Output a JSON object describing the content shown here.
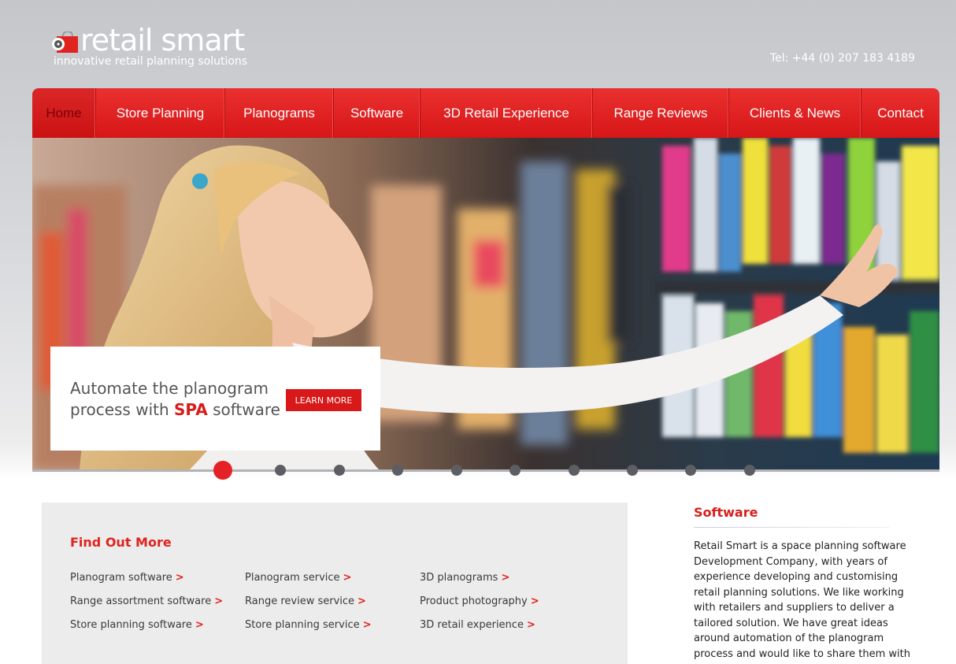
{
  "header": {
    "logo_name": "retail smart",
    "logo_tagline": "innovative retail planning solutions",
    "phone": "Tel: +44 (0) 207 183 4189"
  },
  "nav": {
    "items": [
      {
        "label": "Home",
        "active": true
      },
      {
        "label": "Store Planning"
      },
      {
        "label": "Planograms"
      },
      {
        "label": "Software"
      },
      {
        "label": "3D Retail Experience"
      },
      {
        "label": "Range Reviews"
      },
      {
        "label": "Clients & News"
      },
      {
        "label": "Contact"
      }
    ]
  },
  "hero": {
    "promo_line1": "Automate the planogram",
    "promo_line2_prefix": "process with ",
    "promo_highlight": "SPA",
    "promo_line2_suffix": " software",
    "button_label": "LEARN MORE"
  },
  "slider": {
    "slide_count": 10,
    "active_index": 0
  },
  "find_out_more": {
    "title": "Find Out More",
    "columns": [
      [
        "Planogram software",
        "Range assortment software",
        "Store planning software"
      ],
      [
        "Planogram service",
        "Range review service",
        "Store planning service"
      ],
      [
        "3D planograms",
        "Product photography",
        "3D retail experience"
      ]
    ],
    "arrow": ">"
  },
  "software": {
    "title": "Software",
    "body": "Retail Smart is a space planning software Development Company, with years of experience developing and customising retail planning solutions. We like working with retailers and suppliers to deliver a tailored solution. We have great ideas around automation of the planogram process and would like to share them with"
  },
  "colors": {
    "brand_red": "#d9181a",
    "nav_gradient_top": "#ea3030",
    "nav_gradient_bottom": "#d71617",
    "dot_inactive": "#5d5e63"
  }
}
